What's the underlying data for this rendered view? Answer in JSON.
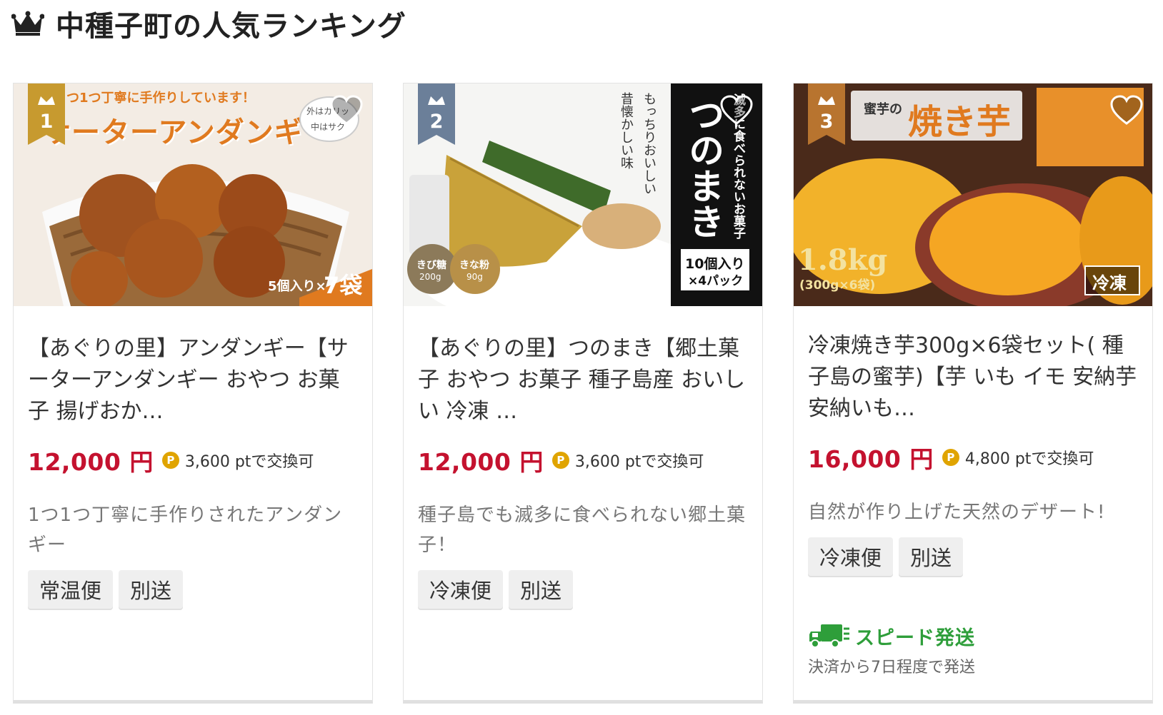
{
  "header": {
    "title": "中種子町の人気ランキング",
    "icon": "crown-icon"
  },
  "colors": {
    "price": "#c4122f",
    "rank_gold": "#c79a2f",
    "rank_blue": "#6b7f99",
    "rank_bronze": "#b8742f",
    "speed": "#2e9e3a",
    "point": "#e0a400"
  },
  "cards": [
    {
      "rank": "1",
      "image_text": {
        "top": "つ1つ丁寧に手作りしています！",
        "title": "サーターアンダンギー",
        "badge_a": "外はカリッ",
        "badge_b": "中はサク",
        "count_a": "5個入り×",
        "count_b": "7袋"
      },
      "name": "【あぐりの里】アンダンギー【サーターアンダンギー おやつ お菓子 揚げおか…",
      "price": "12,000 円",
      "point_icon": "P",
      "points": "3,600 ptで交換可",
      "description": "1つ1つ丁寧に手作りされたアンダンギー",
      "tags": [
        "常温便",
        "別送"
      ]
    },
    {
      "rank": "2",
      "image_text": {
        "title": "つのまき",
        "sub_a": "もっちりおいしい",
        "sub_b": "昔懐かしい味",
        "side": "滅多に食べられないお菓子",
        "label_a": "きび糖",
        "label_a2": "200g",
        "label_b": "きな粉",
        "label_b2": "90g",
        "pack_a": "10個入り",
        "pack_b": "×4パック"
      },
      "name": "【あぐりの里】つのまき【郷土菓子 おやつ お菓子 種子島産 おいしい 冷凍 …",
      "price": "12,000 円",
      "point_icon": "P",
      "points": "3,600 ptで交換可",
      "description": "種子島でも滅多に食べられない郷土菓子！",
      "tags": [
        "冷凍便",
        "別送"
      ]
    },
    {
      "rank": "3",
      "image_text": {
        "title": "焼き芋",
        "sub": "蜜芋の",
        "weight": "1.8kg",
        "weight_sub": "(300g×6袋)",
        "frozen": "冷凍"
      },
      "name": "冷凍焼き芋300g×6袋セット( 種子島の蜜芋)【芋 いも イモ 安納芋 安納いも…",
      "price": "16,000 円",
      "point_icon": "P",
      "points": "4,800 ptで交換可",
      "description": "自然が作り上げた天然のデザート!",
      "tags": [
        "冷凍便",
        "別送"
      ],
      "speed": {
        "label": "スピード発送",
        "note": "決済から7日程度で発送"
      }
    }
  ]
}
